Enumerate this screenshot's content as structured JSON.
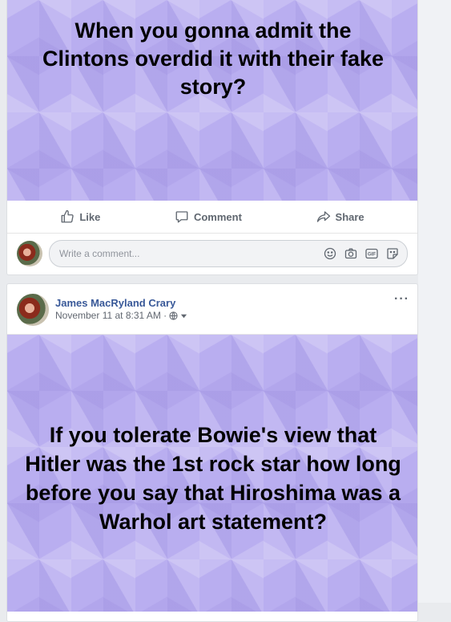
{
  "post1": {
    "text": "When you gonna admit the Clintons overdid it with their fake story?",
    "actions": {
      "like": "Like",
      "comment": "Comment",
      "share": "Share"
    },
    "comment_placeholder": "Write a comment...",
    "comment_icons": [
      "emoji-icon",
      "camera-icon",
      "gif-icon",
      "sticker-icon"
    ]
  },
  "post2": {
    "author": "James MacRyland Crary",
    "timestamp": "November 11 at 8:31 AM ·",
    "privacy_icon": "globe-icon",
    "more": "···",
    "text": "If you tolerate Bowie's view that Hitler was the 1st rock star how long before you say that Hiroshima was a Warhol art statement?"
  },
  "colors": {
    "post_background": "#b9aef0",
    "link_blue": "#385898",
    "muted_text": "#606770"
  }
}
